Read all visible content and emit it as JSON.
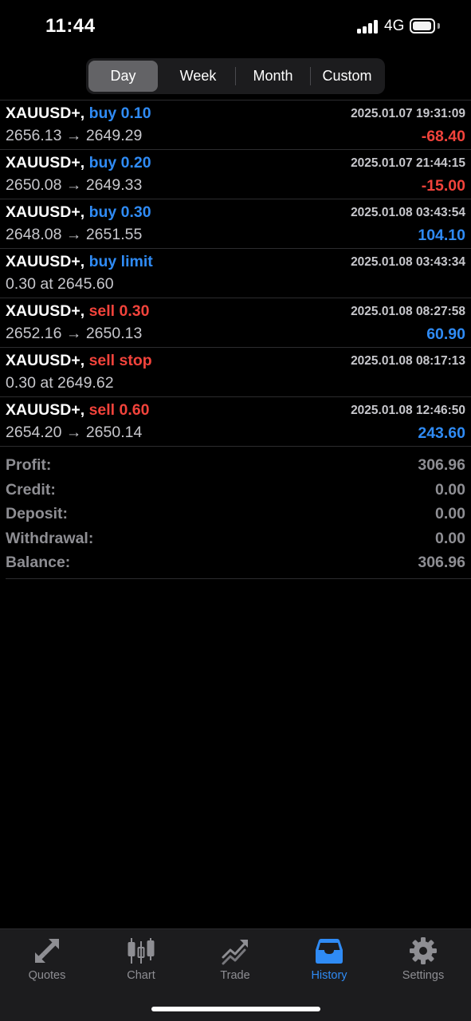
{
  "status_bar": {
    "time": "11:44",
    "network": "4G"
  },
  "period_tabs": [
    {
      "label": "Day",
      "active": true
    },
    {
      "label": "Week",
      "active": false
    },
    {
      "label": "Month",
      "active": false
    },
    {
      "label": "Custom",
      "active": false
    }
  ],
  "history": [
    {
      "symbol": "XAUUSD+,",
      "side": "buy 0.10",
      "type": "buy",
      "time": "2025.01.07 19:31:09",
      "prices": "2656.13 → 2649.29",
      "profit": "-68.40",
      "profit_sign": "neg"
    },
    {
      "symbol": "XAUUSD+,",
      "side": "buy 0.20",
      "type": "buy",
      "time": "2025.01.07 21:44:15",
      "prices": "2650.08 → 2649.33",
      "profit": "-15.00",
      "profit_sign": "neg"
    },
    {
      "symbol": "XAUUSD+,",
      "side": "buy 0.30",
      "type": "buy",
      "time": "2025.01.08 03:43:54",
      "prices": "2648.08 → 2651.55",
      "profit": "104.10",
      "profit_sign": "pos"
    },
    {
      "symbol": "XAUUSD+,",
      "side": "buy limit",
      "type": "buy",
      "time": "2025.01.08 03:43:34",
      "prices": "0.30 at 2645.60",
      "profit": "",
      "profit_sign": ""
    },
    {
      "symbol": "XAUUSD+,",
      "side": "sell 0.30",
      "type": "sell",
      "time": "2025.01.08 08:27:58",
      "prices": "2652.16 → 2650.13",
      "profit": "60.90",
      "profit_sign": "pos"
    },
    {
      "symbol": "XAUUSD+,",
      "side": "sell stop",
      "type": "sell",
      "time": "2025.01.08 08:17:13",
      "prices": "0.30 at 2649.62",
      "profit": "",
      "profit_sign": ""
    },
    {
      "symbol": "XAUUSD+,",
      "side": "sell 0.60",
      "type": "sell",
      "time": "2025.01.08 12:46:50",
      "prices": "2654.20 → 2650.14",
      "profit": "243.60",
      "profit_sign": "pos"
    }
  ],
  "summary": {
    "profit_label": "Profit:",
    "profit": "306.96",
    "credit_label": "Credit:",
    "credit": "0.00",
    "deposit_label": "Deposit:",
    "deposit": "0.00",
    "withdrawal_label": "Withdrawal:",
    "withdrawal": "0.00",
    "balance_label": "Balance:",
    "balance": "306.96"
  },
  "tab_bar": [
    {
      "label": "Quotes",
      "icon": "quotes-arrows-icon",
      "active": false
    },
    {
      "label": "Chart",
      "icon": "candlestick-icon",
      "active": false
    },
    {
      "label": "Trade",
      "icon": "trend-up-icon",
      "active": false
    },
    {
      "label": "History",
      "icon": "inbox-tray-icon",
      "active": true
    },
    {
      "label": "Settings",
      "icon": "gear-icon",
      "active": false
    }
  ],
  "colors": {
    "buy": "#2f8bf5",
    "sell": "#f2433b",
    "accent": "#2f8bf5",
    "muted": "#8e8e93"
  }
}
